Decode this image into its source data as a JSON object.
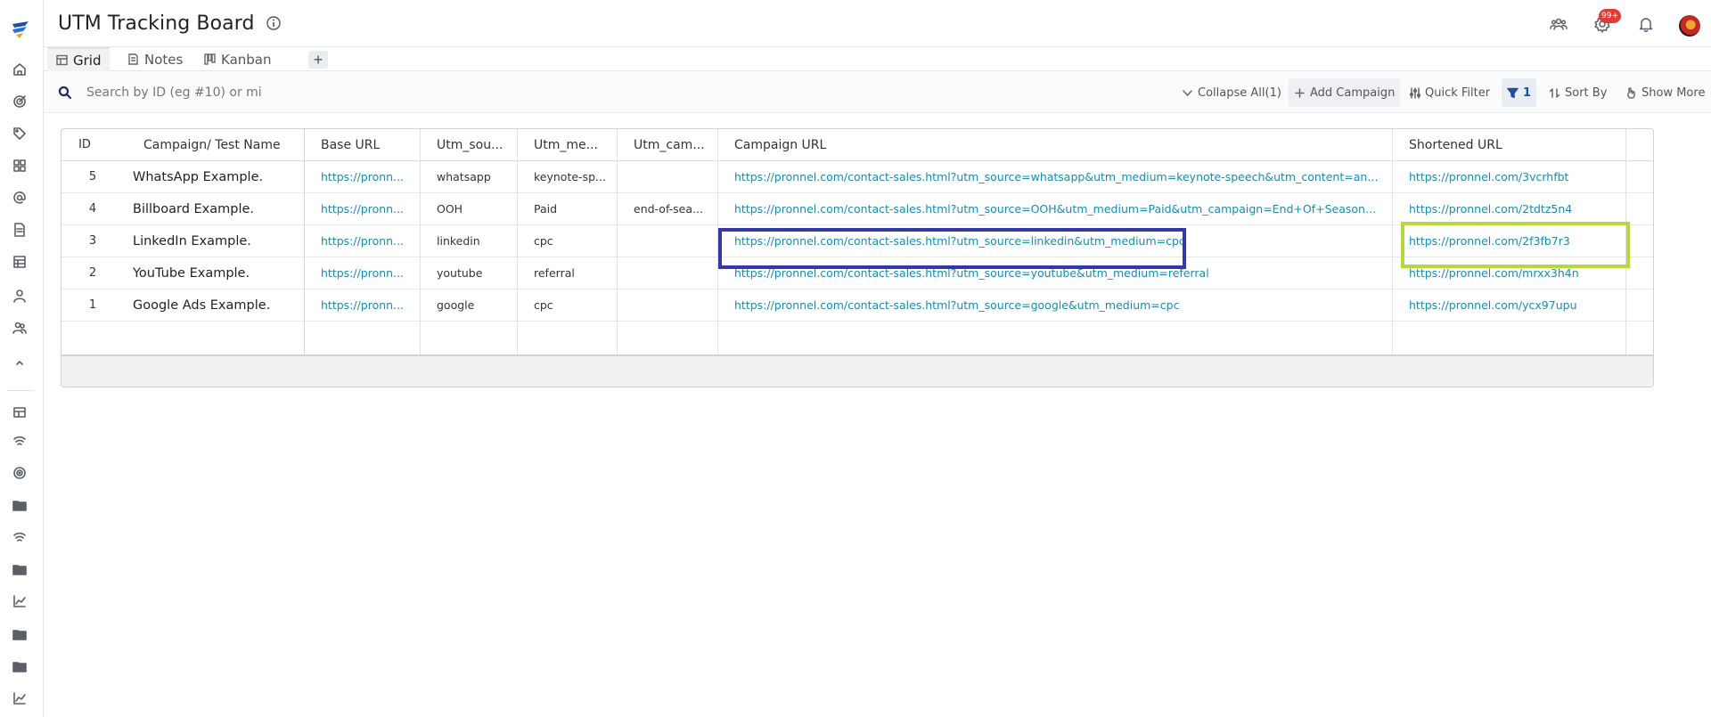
{
  "header": {
    "title": "UTM Tracking Board",
    "notification_count": "99+"
  },
  "tabs": [
    {
      "label": "Grid"
    },
    {
      "label": "Notes"
    },
    {
      "label": "Kanban"
    }
  ],
  "toolbar": {
    "search_placeholder": "Search by ID (eg #10) or mi",
    "collapse_label": "Collapse All(1)",
    "add_label": "Add Campaign",
    "quick_filter_label": "Quick Filter",
    "filter_count": "1",
    "sort_label": "Sort By",
    "more_label": "Show More"
  },
  "grid": {
    "columns": [
      "ID",
      "Campaign/ Test Name",
      "Base URL",
      "Utm_sou...",
      "Utm_me...",
      "Utm_cam...",
      "Campaign URL",
      "Shortened URL"
    ],
    "rows": [
      {
        "id": "5",
        "name": "WhatsApp Example.",
        "base": "https://pronn...",
        "source": "whatsapp",
        "medium": "keynote-sp...",
        "campaign": "",
        "campaign_url": "https://pronnel.com/contact-sales.html?utm_source=whatsapp&utm_medium=keynote-speech&utm_content=annual-con...",
        "short_url": "https://pronnel.com/3vcrhfbt"
      },
      {
        "id": "4",
        "name": "Billboard Example.",
        "base": "https://pronn...",
        "source": "OOH",
        "medium": "Paid",
        "campaign": "end-of-sea...",
        "campaign_url": "https://pronnel.com/contact-sales.html?utm_source=OOH&utm_medium=Paid&utm_campaign=End+Of+Season+Sale&ut...",
        "short_url": "https://pronnel.com/2tdtz5n4"
      },
      {
        "id": "3",
        "name": "LinkedIn Example.",
        "base": "https://pronn...",
        "source": "linkedin",
        "medium": "cpc",
        "campaign": "",
        "campaign_url": "https://pronnel.com/contact-sales.html?utm_source=linkedin&utm_medium=cpc",
        "short_url": "https://pronnel.com/2f3fb7r3"
      },
      {
        "id": "2",
        "name": "YouTube Example.",
        "base": "https://pronn...",
        "source": "youtube",
        "medium": "referral",
        "campaign": "",
        "campaign_url": "https://pronnel.com/contact-sales.html?utm_source=youtube&utm_medium=referral",
        "short_url": "https://pronnel.com/mrxx3h4n"
      },
      {
        "id": "1",
        "name": "Google Ads Example.",
        "base": "https://pronn...",
        "source": "google",
        "medium": "cpc",
        "campaign": "",
        "campaign_url": "https://pronnel.com/contact-sales.html?utm_source=google&utm_medium=cpc",
        "short_url": "https://pronnel.com/ycx97upu"
      }
    ]
  },
  "sidebar": {
    "icons": [
      "logo-icon",
      "home-icon",
      "target-icon",
      "tag-icon",
      "grid-icon",
      "at-icon",
      "document-icon",
      "board-icon",
      "user-icon",
      "users-icon",
      "chevron-up-icon",
      "table-icon",
      "wifi-icon",
      "radar-icon",
      "folder-icon",
      "wifi-icon",
      "folder-icon",
      "chart-icon",
      "folder-icon",
      "folder-icon",
      "chart-icon"
    ]
  },
  "colors": {
    "link": "#1a8cb0",
    "highlight_blue": "#3338a6",
    "highlight_green": "#b5d93a",
    "badge": "#e53935"
  }
}
